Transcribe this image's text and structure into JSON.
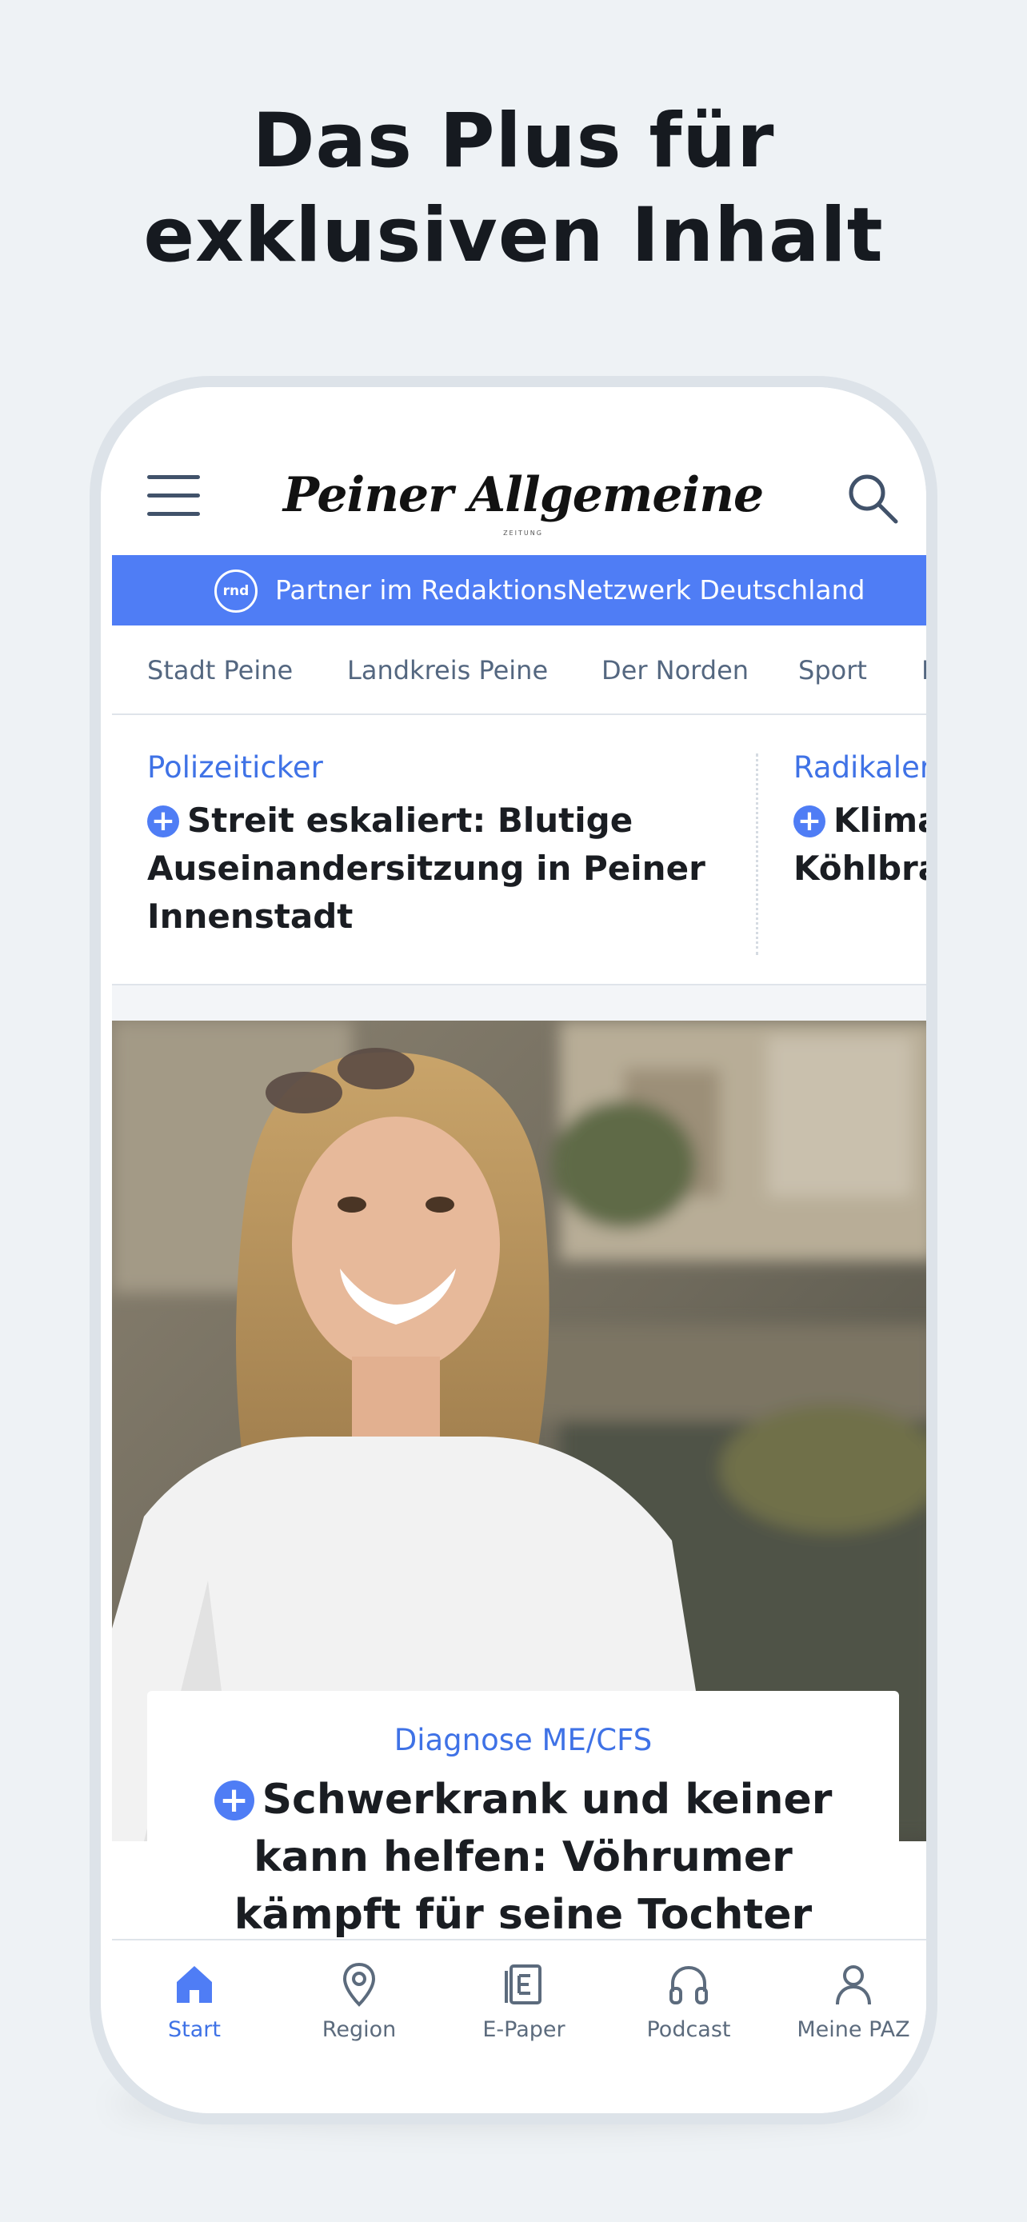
{
  "promo": {
    "headline_line1": "Das Plus für",
    "headline_line2": "exklusiven Inhalt"
  },
  "header": {
    "logo": "Peiner Allgemeine",
    "logo_sub": "ZEITUNG"
  },
  "partner": {
    "badge": "rnd",
    "text": "Partner im RedaktionsNetzwerk Deutschland"
  },
  "nav_tabs": [
    "Stadt Peine",
    "Landkreis Peine",
    "Der Norden",
    "Sport",
    "P"
  ],
  "teasers": [
    {
      "kicker": "Polizeiticker",
      "title": "Streit eskaliert: Blutige Auseinandersitzung in Peiner Innenstadt"
    },
    {
      "kicker": "Radikaler",
      "title": "Klima Köhlbrar"
    }
  ],
  "hero": {
    "kicker": "Diagnose ME/CFS",
    "title": "Schwerkrank und keiner kann helfen: Vöhrumer kämpft für seine Tochter"
  },
  "bottom_nav": [
    {
      "label": "Start",
      "icon": "home-icon",
      "active": true
    },
    {
      "label": "Region",
      "icon": "location-pin-icon",
      "active": false
    },
    {
      "label": "E-Paper",
      "icon": "epaper-icon",
      "active": false
    },
    {
      "label": "Podcast",
      "icon": "headphones-icon",
      "active": false
    },
    {
      "label": "Meine PAZ",
      "icon": "person-icon",
      "active": false
    }
  ],
  "colors": {
    "accent": "#4f7df5",
    "kicker": "#3f72e6",
    "background": "#eef2f5",
    "text": "#1a1d22"
  }
}
